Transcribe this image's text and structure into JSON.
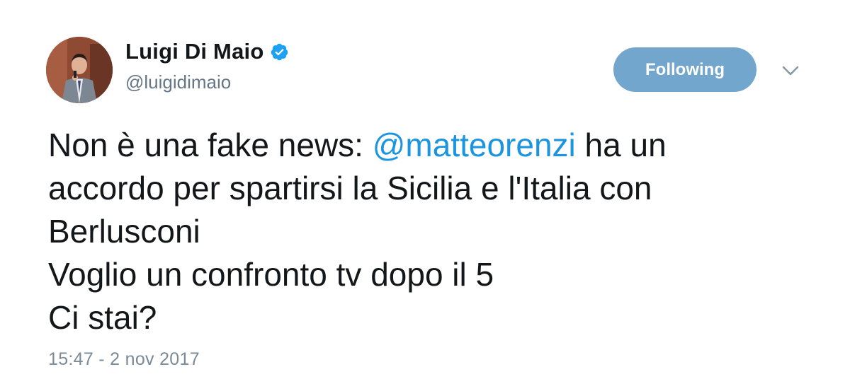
{
  "author": {
    "display_name": "Luigi Di Maio",
    "handle": "@luigidimaio",
    "verified": true
  },
  "actions": {
    "follow_label": "Following",
    "follow_color": "#73a6cc"
  },
  "tweet": {
    "line1_pre": "Non è una fake news: ",
    "mention": "@matteorenzi",
    "line1_post": " ha un",
    "line2": "accordo per spartirsi la Sicilia e l'Italia con",
    "line3": "Berlusconi",
    "line4": "Voglio un confronto tv dopo il 5",
    "line5": "Ci stai?",
    "mention_color": "#1b95e0"
  },
  "meta": {
    "timestamp": "15:47 - 2 nov 2017"
  }
}
